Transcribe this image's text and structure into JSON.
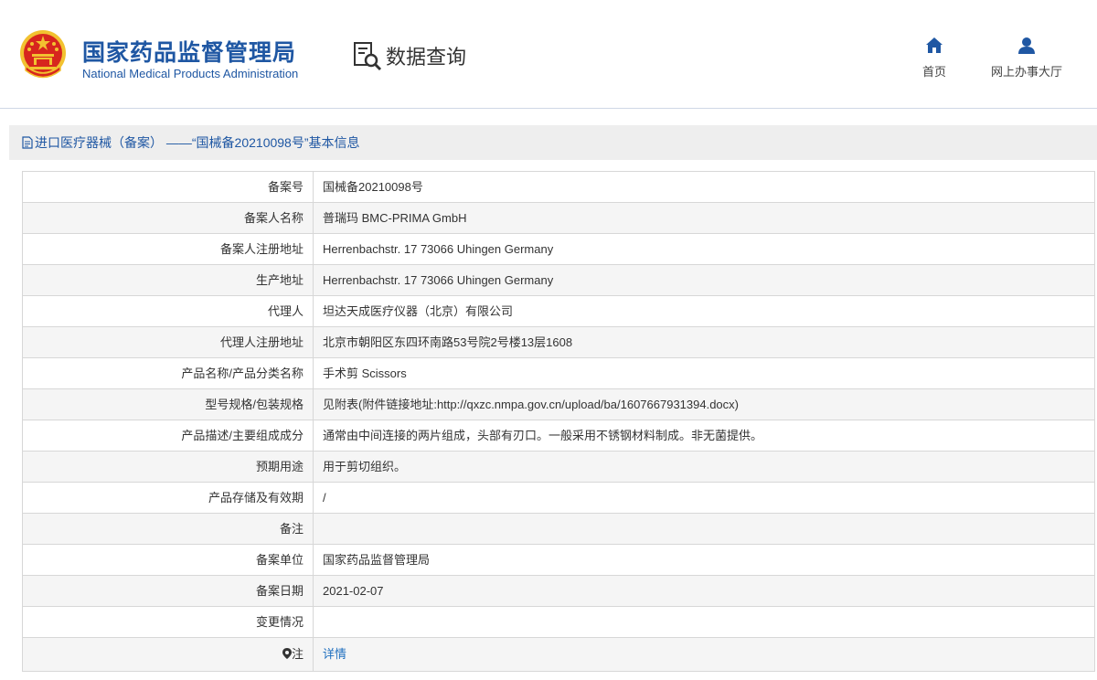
{
  "header": {
    "org_name_cn": "国家药品监督管理局",
    "org_name_en": "National Medical Products Administration",
    "data_query": "数据查询",
    "nav": [
      {
        "label": "首页",
        "icon": "home-icon"
      },
      {
        "label": "网上办事大厅",
        "icon": "user-icon"
      }
    ]
  },
  "panel": {
    "title": "进口医疗器械（备案） ——“国械备20210098号”基本信息"
  },
  "record": {
    "rows": [
      {
        "label": "备案号",
        "value": "国械备20210098号"
      },
      {
        "label": "备案人名称",
        "value": "普瑞玛 BMC-PRIMA GmbH"
      },
      {
        "label": "备案人注册地址",
        "value": "Herrenbachstr. 17 73066 Uhingen Germany"
      },
      {
        "label": "生产地址",
        "value": "Herrenbachstr. 17 73066 Uhingen Germany"
      },
      {
        "label": "代理人",
        "value": "坦达天成医疗仪器（北京）有限公司"
      },
      {
        "label": "代理人注册地址",
        "value": "北京市朝阳区东四环南路53号院2号楼13层1608"
      },
      {
        "label": "产品名称/产品分类名称",
        "value": "手术剪 Scissors"
      },
      {
        "label": "型号规格/包装规格",
        "value": "见附表(附件链接地址:http://qxzc.nmpa.gov.cn/upload/ba/1607667931394.docx)"
      },
      {
        "label": "产品描述/主要组成成分",
        "value": "通常由中间连接的两片组成，头部有刃口。一般采用不锈钢材料制成。非无菌提供。"
      },
      {
        "label": "预期用途",
        "value": "用于剪切组织。"
      },
      {
        "label": "产品存储及有效期",
        "value": "/"
      },
      {
        "label": "备注",
        "value": ""
      },
      {
        "label": "备案单位",
        "value": "国家药品监督管理局"
      },
      {
        "label": "备案日期",
        "value": "2021-02-07"
      },
      {
        "label": "变更情况",
        "value": ""
      }
    ],
    "note_label": "注",
    "note_link": "详情"
  },
  "colors": {
    "brand_blue": "#1f57a3",
    "link_blue": "#1f6fbf",
    "emblem_red": "#d7261e",
    "emblem_gold": "#f2c230"
  }
}
